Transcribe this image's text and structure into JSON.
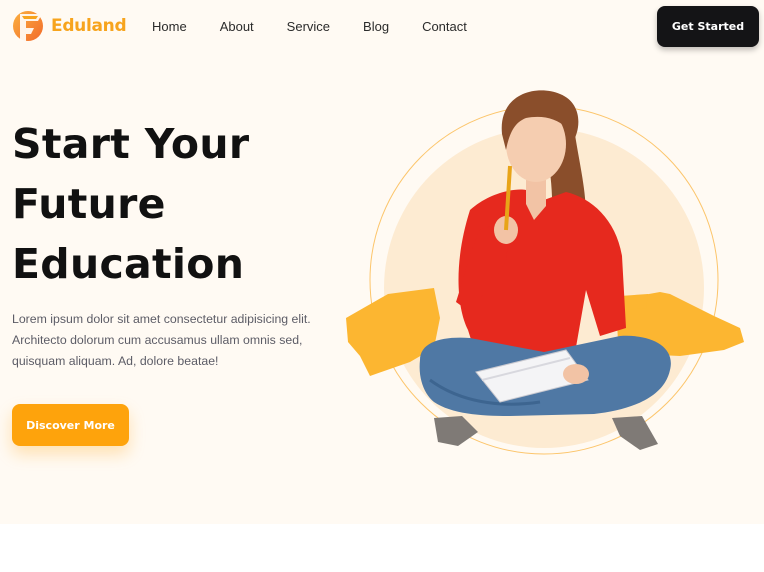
{
  "brand": {
    "name": "Eduland",
    "accent": "#f7a41d"
  },
  "nav": {
    "items": [
      {
        "label": "Home"
      },
      {
        "label": "About"
      },
      {
        "label": "Service"
      },
      {
        "label": "Blog"
      },
      {
        "label": "Contact"
      }
    ],
    "cta_label": "Get Started"
  },
  "hero": {
    "title_lines": [
      "Start Your",
      "Future",
      "Education"
    ],
    "description": "Lorem ipsum dolor sit amet consectetur adipisicing elit. Architecto dolorum cum accusamus ullam omnis sed, quisquam aliquam. Ad, dolore beatae!",
    "cta_label": "Discover More",
    "image_icon": "student-photo",
    "colors": {
      "background": "#fffaf3",
      "circle": "#fdebd2",
      "brush": "#fcb631",
      "cta": "#fea30c",
      "dark_button": "#141416"
    }
  }
}
